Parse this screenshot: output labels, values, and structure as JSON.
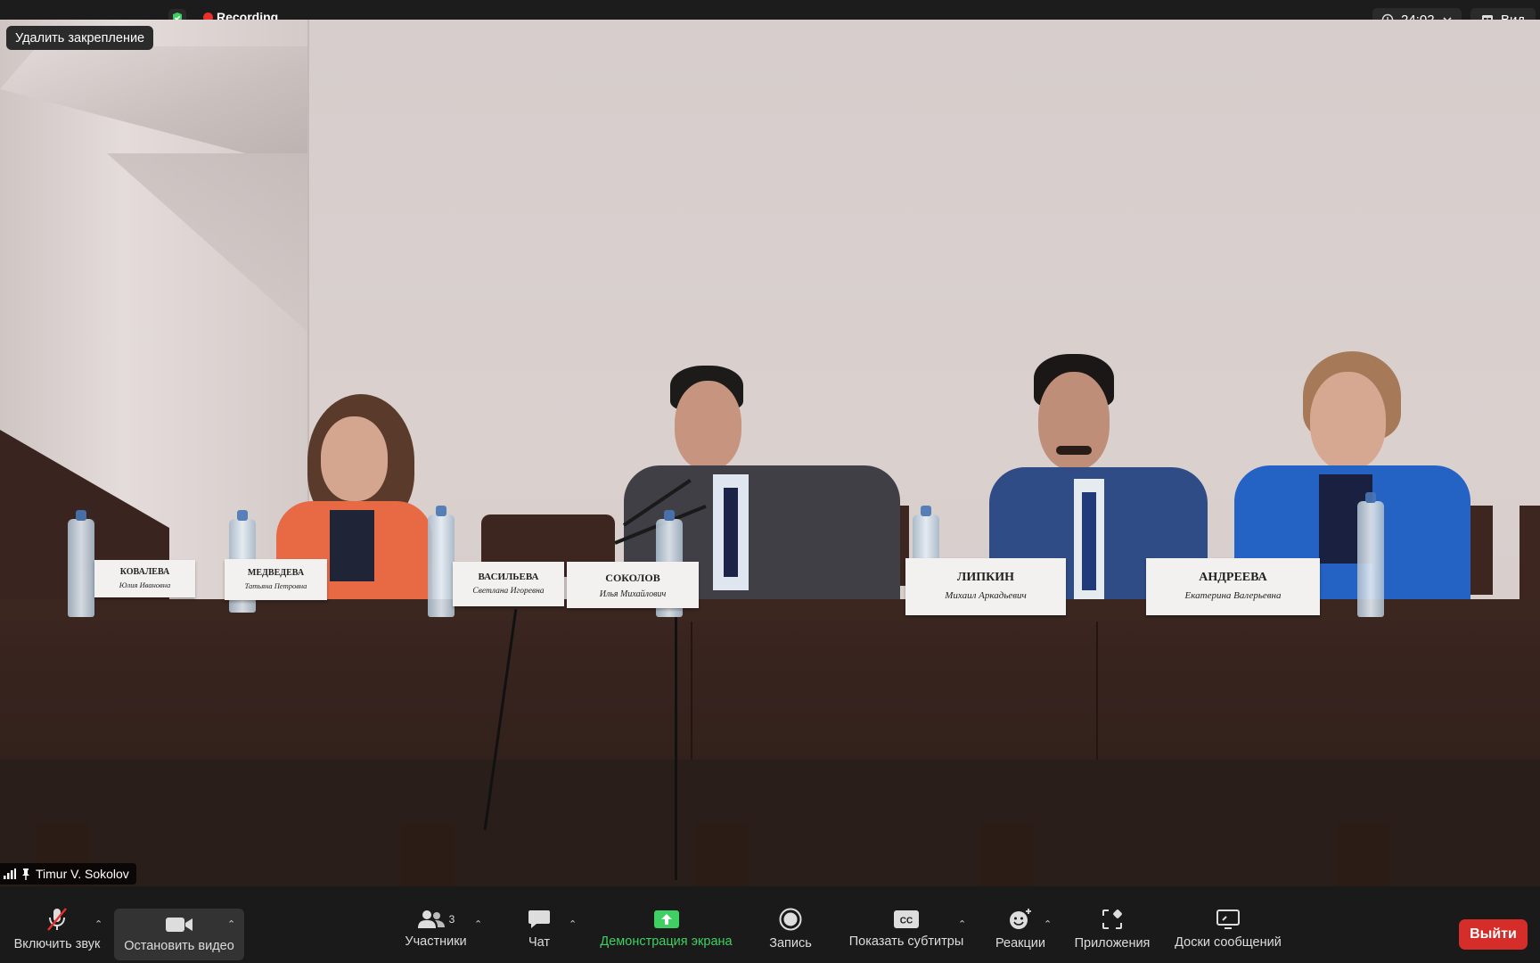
{
  "topbar": {
    "recording_label": "Recording",
    "timer": "24:02",
    "view_label": "Вид",
    "unpin_label": "Удалить закрепление"
  },
  "video": {
    "participant_name": "Timur V. Sokolov",
    "nameplates": [
      {
        "line1": "КОВАЛЕВА",
        "line2": "Юлия Ивановна"
      },
      {
        "line1": "МЕДВЕДЕВА",
        "line2": "Татьяна Петровна"
      },
      {
        "line1": "ВАСИЛЬЕВА",
        "line2": "Светлана Игоревна"
      },
      {
        "line1": "СОКОЛОВ",
        "line2": "Илья Михайлович"
      },
      {
        "line1": "ЛИПКИН",
        "line2": "Михаил Аркадьевич"
      },
      {
        "line1": "АНДРЕЕВА",
        "line2": "Екатерина Валерьевна"
      }
    ]
  },
  "toolbar": {
    "mute_label": "Включить звук",
    "video_label": "Остановить видео",
    "participants_label": "Участники",
    "participants_count": "3",
    "chat_label": "Чат",
    "share_label": "Демонстрация экрана",
    "record_label": "Запись",
    "captions_label": "Показать субтитры",
    "reactions_label": "Реакции",
    "apps_label": "Приложения",
    "whiteboards_label": "Доски сообщений",
    "leave_label": "Выйти"
  },
  "colors": {
    "accent_green": "#3fcf62",
    "recording_red": "#e8312b",
    "leave_red": "#d42d2a"
  }
}
